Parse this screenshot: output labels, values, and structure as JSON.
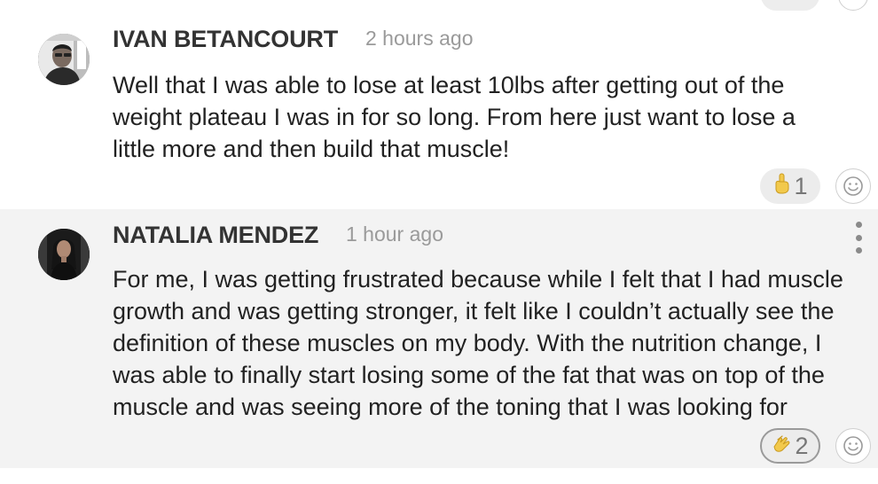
{
  "previous": {
    "reaction_count": "",
    "has_reaction_pill": true
  },
  "comments": [
    {
      "author": "IVAN BETANCOURT",
      "time": "2 hours ago",
      "lines": [
        "Well that I was able to lose at least 10lbs after getting out of the",
        "weight plateau I was in for so long. From here just want to lose a",
        "little more and then build that muscle!"
      ],
      "reaction": {
        "icon": "pointing-hand-icon",
        "count": "1"
      },
      "add_reaction_icon": "smiley-icon"
    },
    {
      "author": "NATALIA MENDEZ",
      "time": "1 hour ago",
      "lines": [
        "For me, I was getting frustrated because while I felt that I had muscle",
        "growth and was getting stronger, it felt like I couldn’t actually see the",
        "definition of these muscles on my body. With the nutrition change, I",
        "was able to finally start losing some of the fat that was on top of the",
        "muscle and was seeing more of the toning that I was looking for"
      ],
      "reaction": {
        "icon": "clapping-hands-icon",
        "count": "2"
      },
      "add_reaction_icon": "smiley-icon",
      "menu_icon": "more-vertical-icon"
    }
  ],
  "colors": {
    "highlight_bg": "#f3f3f3",
    "pill_bg": "#ececec",
    "emoji_yellow": "#f2c94c"
  }
}
